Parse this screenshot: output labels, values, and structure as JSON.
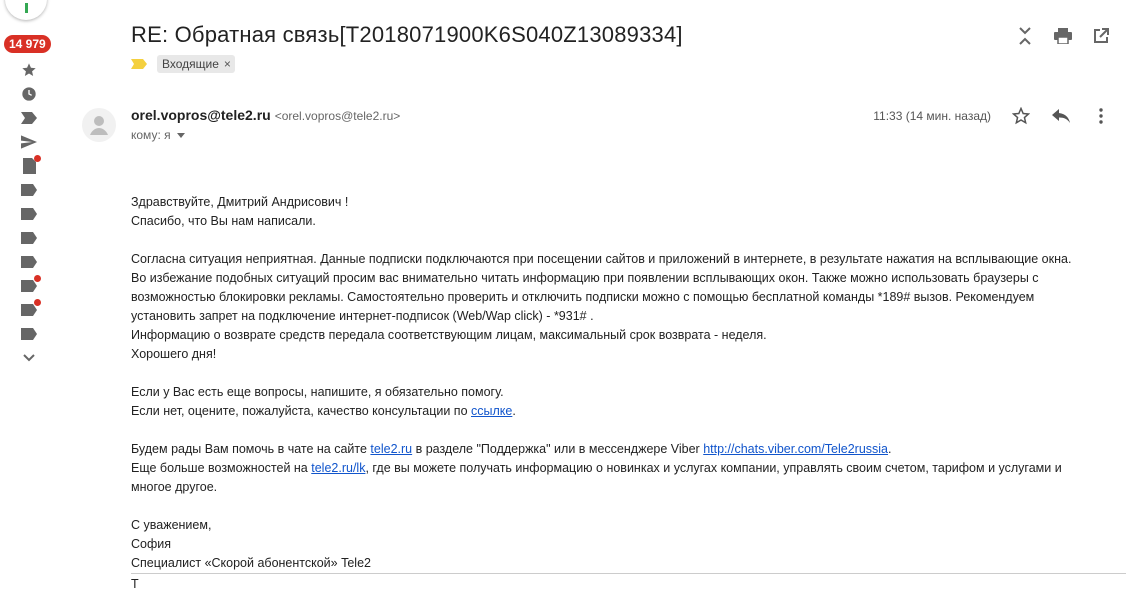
{
  "rail": {
    "unread_count": "14 979",
    "icons": [
      "star-icon",
      "clock-icon",
      "important-icon",
      "send-icon",
      "draft-icon",
      "label-icon",
      "label-icon",
      "label-icon",
      "label-icon",
      "label-icon",
      "label-icon",
      "label-icon",
      "label-icon",
      "more-icon"
    ]
  },
  "email": {
    "subject": "RE: Обратная связь[T2018071900K6S040Z13089334]",
    "label_chip": "Входящие",
    "label_chip_remove": "×",
    "sender_name": "orel.vopros@tele2.ru",
    "sender_email": "<orel.vopros@tele2.ru>",
    "to": "кому: я",
    "time": "11:33 (14 мин. назад)"
  },
  "body": {
    "greeting": "Здравствуйте, Дмитрий Андрисович !",
    "thanks": "Спасибо, что Вы нам написали.",
    "p1_line1": "Согласна ситуация неприятная. Данные подписки подключаются при посещении сайтов и приложений в интернете, в результате нажатия на всплывающие окна.",
    "p1_line2": "Во избежание подобных ситуаций просим вас внимательно читать информацию при появлении всплывающих окон. Также можно использовать браузеры с",
    "p1_line3": "возможностью блокировки рекламы. Самостоятельно проверить и отключить подписки можно с помощью бесплатной команды *189# вызов. Рекомендуем",
    "p1_line4": "установить запрет на подключение интернет-подписок (Web/Wap click) - *931# .",
    "p1_line5": "Информацию о возврате средств передала соответствующим лицам, максимальный срок возврата - неделя.",
    "p1_line6": "Хорошего дня!",
    "q1": "Если у Вас есть еще вопросы, напишите, я обязательно помогу.",
    "q2_pre": "Если нет, оцените, пожалуйста, качество консультации по ",
    "q2_link": "ссылке",
    "q2_post": ".",
    "c1_pre": "Будем рады Вам помочь в чате на сайте ",
    "c1_link1": "tele2.ru",
    "c1_mid": " в разделе \"Поддержка\" или в мессенджере Viber ",
    "c1_link2": "http://chats.viber.com/Tele2russia",
    "c1_post": ".",
    "c2_pre": "Еще больше возможностей на ",
    "c2_link": "tele2.ru/lk",
    "c2_post": ", где вы можете получать информацию о новинках и услугах компании, управлять своим счетом, тарифом и услугами и",
    "c2_line2": "многое другое.",
    "sig1": "С уважением,",
    "sig2": "София",
    "sig3": "Специалист «Скорой абонентской» Tele2",
    "cut": "Т"
  },
  "colors": {
    "badge": "#d93025",
    "link": "#1155cc",
    "important_marker": "#f4d03f"
  }
}
